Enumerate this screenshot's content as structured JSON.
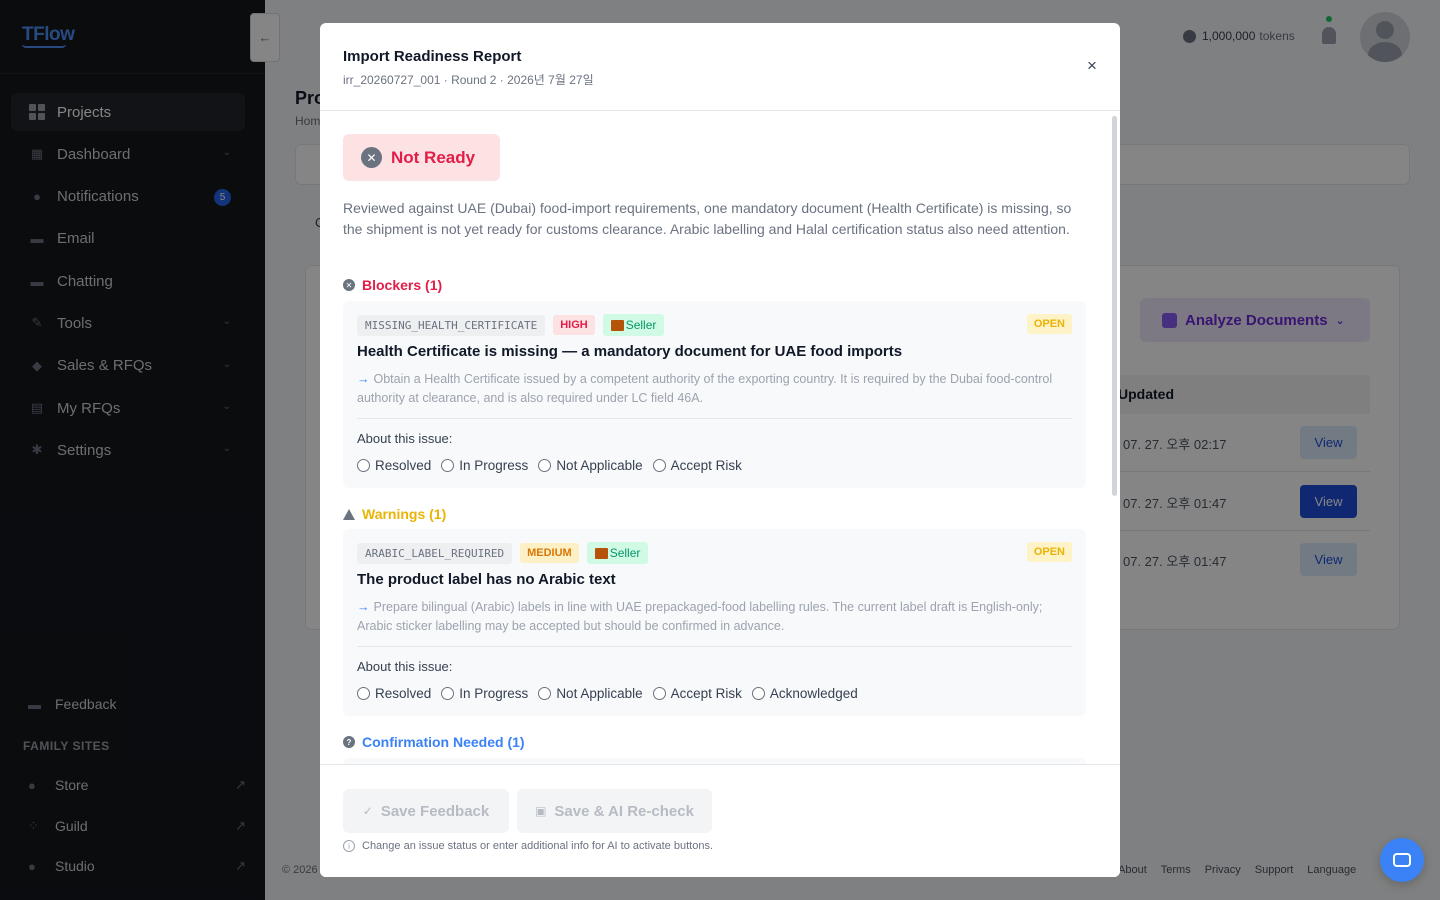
{
  "brand": {
    "logo": "TFlow"
  },
  "sidebar": {
    "items": [
      {
        "label": "Projects",
        "icon": "grid-icon"
      },
      {
        "label": "Dashboard",
        "icon": "dashboard-icon"
      },
      {
        "label": "Notifications",
        "icon": "bell-icon",
        "badge": "5"
      },
      {
        "label": "Email",
        "icon": "email-icon"
      },
      {
        "label": "Chatting",
        "icon": "chat-icon"
      },
      {
        "label": "Tools",
        "icon": "wrench-icon"
      },
      {
        "label": "Sales & RFQs",
        "icon": "box-icon"
      },
      {
        "label": "My RFQs",
        "icon": "document-icon"
      },
      {
        "label": "Settings",
        "icon": "gear-icon"
      }
    ],
    "feedback": "Feedback",
    "family_title": "FAMILY SITES",
    "family_sites": [
      "Store",
      "Guild",
      "Studio"
    ]
  },
  "header": {
    "tokens": "1,000,000",
    "tokens_unit": "tokens"
  },
  "page": {
    "title": "Pro",
    "breadcrumb": "Hom",
    "tab": "C",
    "analyze_button": "Analyze Documents",
    "table_header": "Updated",
    "rows": [
      {
        "date": "07. 27. 오후 02:17",
        "action": "View"
      },
      {
        "date": "07. 27. 오후 01:47",
        "action": "View"
      },
      {
        "date": "07. 27. 오후 01:47",
        "action": "View"
      }
    ],
    "footer_left": "© 2026",
    "footer_links": [
      "About",
      "Terms",
      "Privacy",
      "Support",
      "Language"
    ]
  },
  "modal": {
    "title": "Import Readiness Report",
    "subtitle": "irr_20260727_001 · Round 2 · 2026년 7월 27일",
    "close": "×",
    "status": "Not Ready",
    "summary": "Reviewed against UAE (Dubai) food-import requirements, one mandatory document (Health Certificate) is missing, so the shipment is not yet ready for customs clearance. Arabic labelling and Halal certification status also need attention.",
    "blockers_title": "Blockers (1)",
    "warnings_title": "Warnings (1)",
    "confirm_title": "Confirmation Needed (1)",
    "blocker": {
      "code": "MISSING_HEALTH_CERTIFICATE",
      "severity": "HIGH",
      "party": "Seller",
      "state": "OPEN",
      "title": "Health Certificate is missing — a mandatory document for UAE food imports",
      "arrow": "→",
      "action": "Obtain a Health Certificate issued by a competent authority of the exporting country. It is required by the Dubai food-control authority at clearance, and is also required under LC field 46A.",
      "about": "About this issue:",
      "options": [
        "Resolved",
        "In Progress",
        "Not Applicable",
        "Accept Risk"
      ]
    },
    "warning": {
      "code": "ARABIC_LABEL_REQUIRED",
      "severity": "MEDIUM",
      "party": "Seller",
      "state": "OPEN",
      "title": "The product label has no Arabic text",
      "arrow": "→",
      "action": "Prepare bilingual (Arabic) labels in line with UAE prepackaged-food labelling rules. The current label draft is English-only; Arabic sticker labelling may be accepted but should be confirmed in advance.",
      "about": "About this issue:",
      "options": [
        "Resolved",
        "In Progress",
        "Not Applicable",
        "Accept Risk",
        "Acknowledged"
      ]
    },
    "footer": {
      "save": "Save Feedback",
      "recheck": "Save & AI Re-check",
      "hint": "Change an issue status or enter additional info for AI to activate buttons."
    }
  }
}
